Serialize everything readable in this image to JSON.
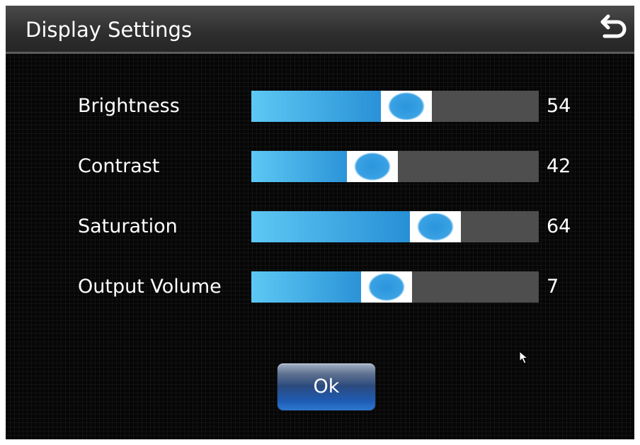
{
  "window": {
    "title": "Display Settings"
  },
  "icons": {
    "back": "back-arrow-icon",
    "cursor": "mouse-pointer-icon"
  },
  "colors": {
    "accent": "#2b95dc",
    "track": "#4e4e4e",
    "background": "#060606"
  },
  "sliders": [
    {
      "label": "Brightness",
      "value": "54",
      "fraction": 0.54
    },
    {
      "label": "Contrast",
      "value": "42",
      "fraction": 0.42
    },
    {
      "label": "Saturation",
      "value": "64",
      "fraction": 0.64
    },
    {
      "label": "Output Volume",
      "value": "7",
      "fraction": 0.47
    }
  ],
  "ok_button": {
    "label": "Ok"
  }
}
